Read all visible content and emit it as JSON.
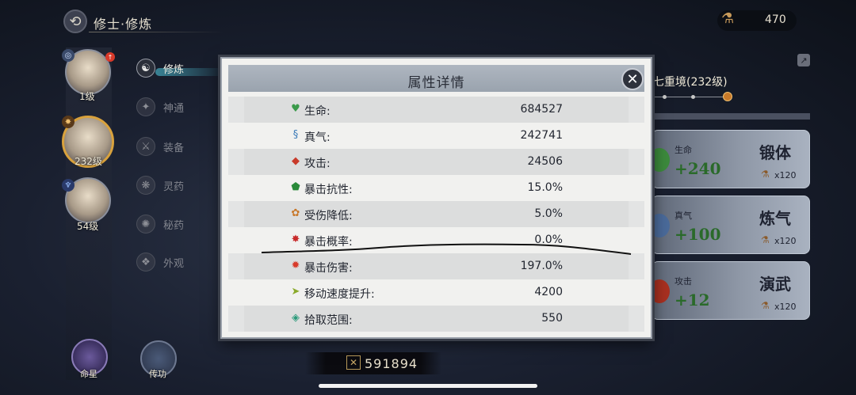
{
  "header": {
    "back_glyph": "⟲",
    "title": "修士·修炼",
    "currency_icon": "bottle-icon",
    "currency_value": "470"
  },
  "characters": [
    {
      "level": "1级",
      "selected": false
    },
    {
      "level": "232级",
      "selected": true
    },
    {
      "level": "54级",
      "selected": false
    }
  ],
  "menu": [
    {
      "label": "修炼",
      "glyph": "☯",
      "active": true
    },
    {
      "label": "神通",
      "glyph": "✦",
      "active": false
    },
    {
      "label": "装备",
      "glyph": "⚔",
      "active": false
    },
    {
      "label": "灵药",
      "glyph": "❋",
      "active": false
    },
    {
      "label": "秘药",
      "glyph": "✺",
      "active": false
    },
    {
      "label": "外观",
      "glyph": "❖",
      "active": false
    }
  ],
  "bottom_buttons": {
    "fate_star": "命星",
    "inherit": "传功"
  },
  "power": {
    "icon": "crossed-swords-icon",
    "value": "591894"
  },
  "realm": {
    "title": "七重境(232级)"
  },
  "cards": [
    {
      "stat": "生命",
      "bonus": "+240",
      "action": "锻体",
      "cost": "x120",
      "orb_color": "#3c8a3c"
    },
    {
      "stat": "真气",
      "bonus": "+100",
      "action": "炼气",
      "cost": "x120",
      "orb_color": "#4a6a9a"
    },
    {
      "stat": "攻击",
      "bonus": "+12",
      "action": "演武",
      "cost": "x120",
      "orb_color": "#a83020"
    }
  ],
  "modal": {
    "title": "属性详情",
    "close_glyph": "✕",
    "rows": [
      {
        "label": "生命:",
        "value": "684527",
        "icon": "heart-icon",
        "glyph": "♥",
        "color": "#3a9a4a"
      },
      {
        "label": "真气:",
        "value": "242741",
        "icon": "qi-swirl-icon",
        "glyph": "§",
        "color": "#3a7ab8"
      },
      {
        "label": "攻击:",
        "value": "24506",
        "icon": "blade-icon",
        "glyph": "◆",
        "color": "#c83a2a"
      },
      {
        "label": "暴击抗性:",
        "value": "15.0%",
        "icon": "shield-icon",
        "glyph": "⬟",
        "color": "#2a8a3a"
      },
      {
        "label": "受伤降低:",
        "value": "5.0%",
        "icon": "armor-icon",
        "glyph": "✿",
        "color": "#c8782a"
      },
      {
        "label": "暴击概率:",
        "value": "0.0%",
        "icon": "crit-burst-icon",
        "glyph": "✸",
        "color": "#c82a2a"
      },
      {
        "label": "暴击伤害:",
        "value": "197.0%",
        "icon": "crit-damage-icon",
        "glyph": "✹",
        "color": "#d83a2a"
      },
      {
        "label": "移动速度提升:",
        "value": "4200",
        "icon": "boot-icon",
        "glyph": "➤",
        "color": "#8aaa2a"
      },
      {
        "label": "拾取范围:",
        "value": "550",
        "icon": "magnet-icon",
        "glyph": "◈",
        "color": "#2a9a7a"
      }
    ]
  }
}
